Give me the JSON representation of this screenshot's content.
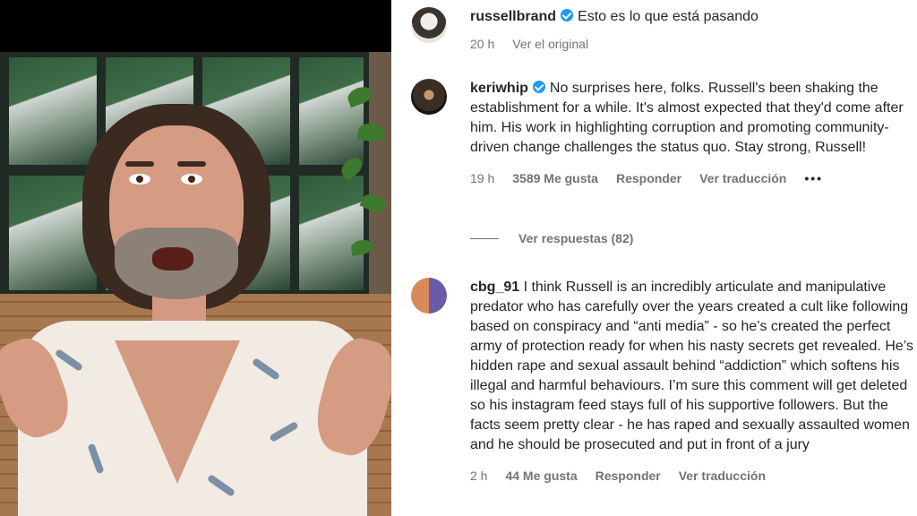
{
  "video": {
    "description_icons": [
      "person-icon"
    ]
  },
  "comments": [
    {
      "username": "russellbrand",
      "verified": true,
      "text": "Esto es lo que está pasando",
      "time": "20 h",
      "action": "Ver el original"
    },
    {
      "username": "keriwhip",
      "verified": true,
      "text": "No surprises here, folks. Russell's been shaking the establishment for a while. It's almost expected that they'd come after him. His work in highlighting corruption and promoting community-driven change challenges the status quo. Stay strong, Russell!",
      "time": "19 h",
      "likes": "3589 Me gusta",
      "reply": "Responder",
      "translate": "Ver traducción",
      "more": "•••",
      "view_replies": "Ver respuestas (82)"
    },
    {
      "username": "cbg_91",
      "verified": false,
      "text": "I think Russell is an incredibly articulate and manipulative predator who has carefully over the years created a cult like following based on conspiracy and “anti media” - so he’s created the perfect army of protection ready for when his nasty secrets get revealed. He’s hidden rape and sexual assault behind “addiction” which softens his illegal and harmful behaviours. I’m sure this comment will get deleted so his instagram feed stays full of his supportive followers. But the facts seem pretty clear - he has raped and sexually assaulted women and he should be prosecuted and put in front of a jury",
      "time": "2 h",
      "likes": "44 Me gusta",
      "reply": "Responder",
      "translate": "Ver traducción"
    }
  ],
  "colors": {
    "text": "#262626",
    "muted": "#737373",
    "verified": "#1d9bf0"
  }
}
